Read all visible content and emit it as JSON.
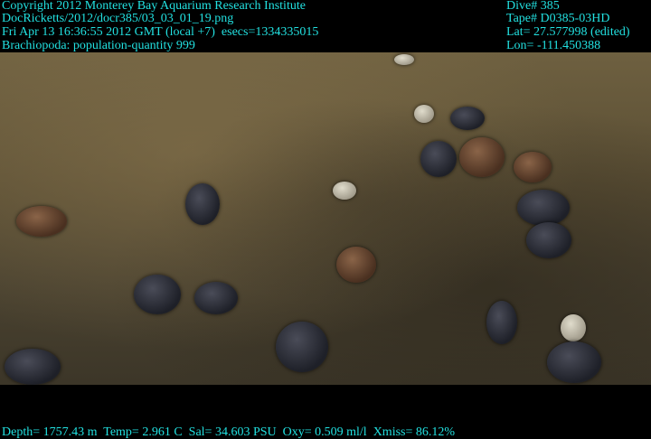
{
  "overlay_top_left": {
    "copyright": "Copyright 2012 Monterey Bay Aquarium Research Institute",
    "file": "DocRicketts/2012/docr385/03_03_01_19.png",
    "datetime": "Fri Apr 13 16:36:55 2012 GMT (local +7)  esecs=1334335015",
    "annotation": "Brachiopoda: population-quantity 999"
  },
  "overlay_top_right": {
    "dive": "Dive# 385",
    "tape": "Tape# D0385-03HD",
    "lat": "Lat= 27.577998 (edited)",
    "lon": "Lon= -111.450388"
  },
  "overlay_bottom": {
    "sensors": "Depth= 1757.43 m  Temp= 2.961 C  Sal= 34.603 PSU  Oxy= 0.509 ml/l  Xmiss= 86.12%"
  },
  "colors": {
    "overlay_text": "#22e0e0"
  }
}
